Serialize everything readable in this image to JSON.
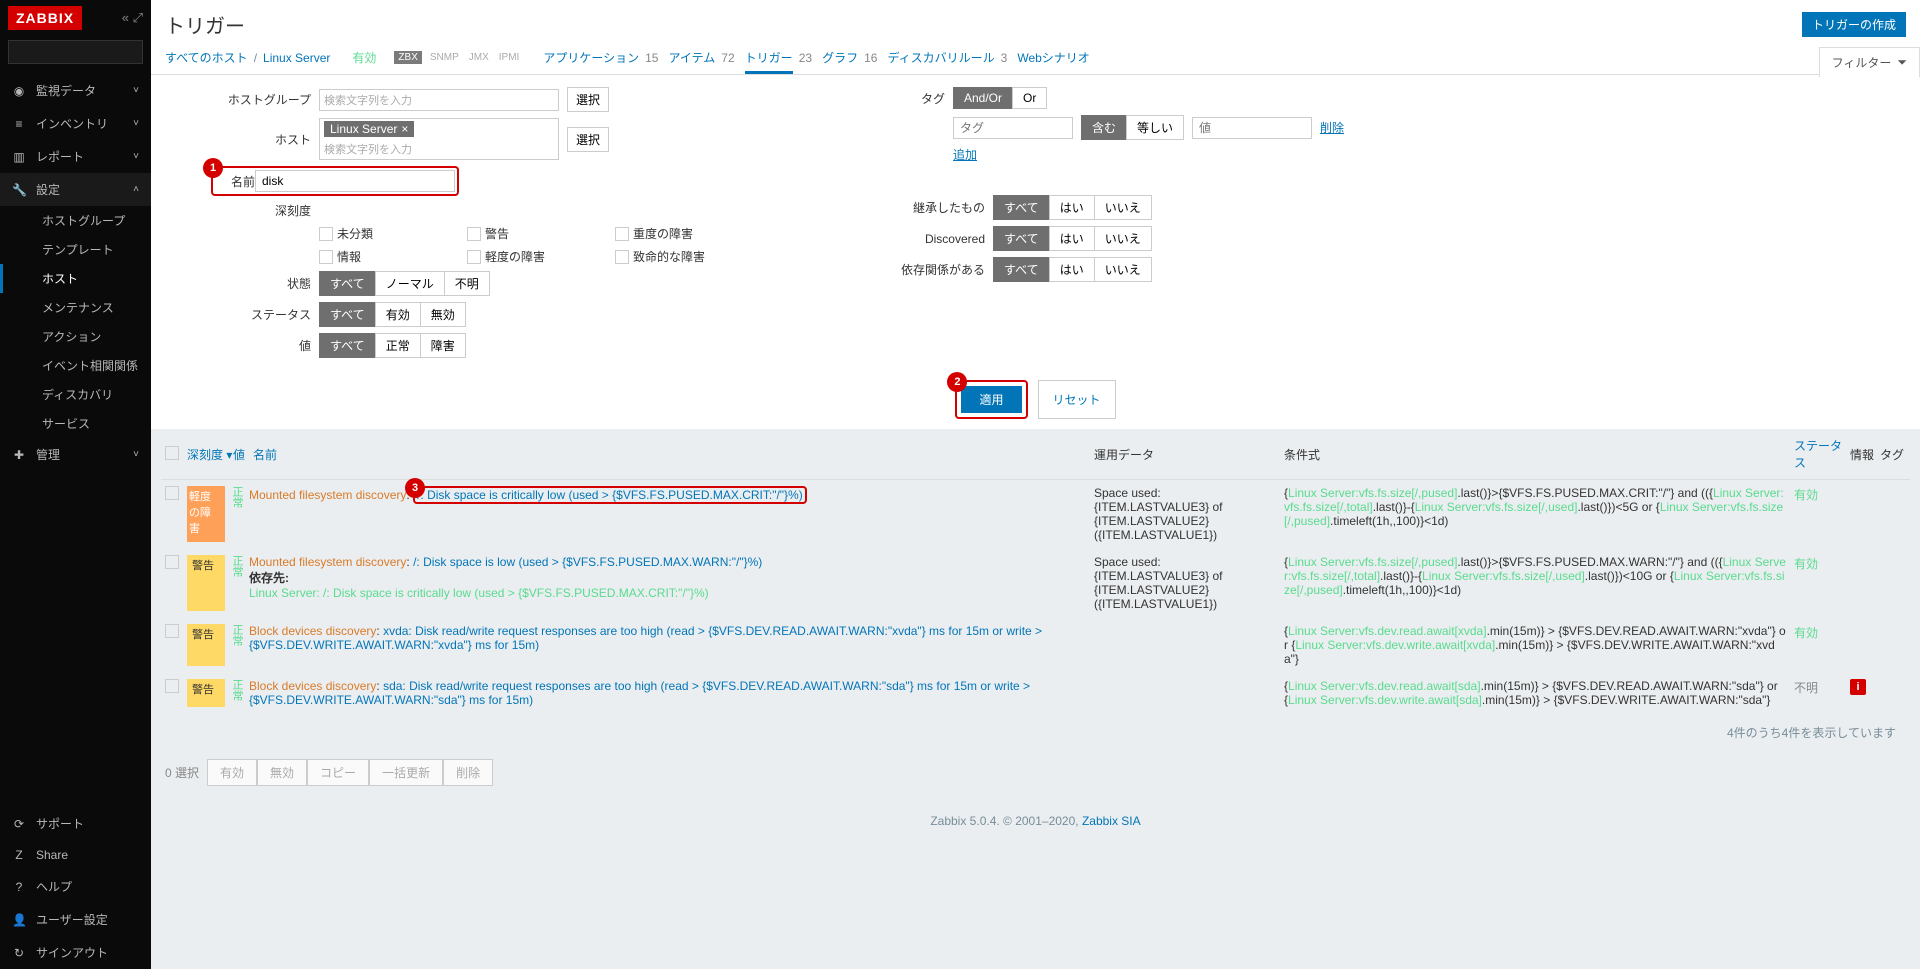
{
  "sidebar": {
    "logo": "ZABBIX",
    "nav": [
      {
        "icon": "◉",
        "label": "監視データ"
      },
      {
        "icon": "≡",
        "label": "インベントリ"
      },
      {
        "icon": "▥",
        "label": "レポート"
      },
      {
        "icon": "🔧",
        "label": "設定",
        "expanded": true,
        "sub": [
          "ホストグループ",
          "テンプレート",
          "ホスト",
          "メンテナンス",
          "アクション",
          "イベント相関関係",
          "ディスカバリ",
          "サービス"
        ],
        "selected": 2
      },
      {
        "icon": "✚",
        "label": "管理"
      }
    ],
    "footer": [
      {
        "icon": "⟳",
        "label": "サポート"
      },
      {
        "icon": "Z",
        "label": "Share"
      },
      {
        "icon": "?",
        "label": "ヘルプ"
      },
      {
        "icon": "👤",
        "label": "ユーザー設定"
      },
      {
        "icon": "↻",
        "label": "サインアウト"
      }
    ]
  },
  "header": {
    "title": "トリガー",
    "create": "トリガーの作成"
  },
  "hostbar": {
    "all": "すべてのホスト",
    "host": "Linux Server",
    "enabled": "有効",
    "zbx": "ZBX",
    "snmp": "SNMP",
    "jmx": "JMX",
    "ipmi": "IPMI",
    "links": [
      {
        "label": "アプリケーション",
        "count": "15"
      },
      {
        "label": "アイテム",
        "count": "72"
      },
      {
        "label": "トリガー",
        "count": "23",
        "active": true
      },
      {
        "label": "グラフ",
        "count": "16"
      },
      {
        "label": "ディスカバリルール",
        "count": "3"
      },
      {
        "label": "Webシナリオ",
        "count": ""
      }
    ],
    "filter": "フィルター"
  },
  "filter": {
    "hostgroup_label": "ホストグループ",
    "hostgroup_placeholder": "検索文字列を入力",
    "select": "選択",
    "host_label": "ホスト",
    "host_value": "Linux Server",
    "host_placeholder": "検索文字列を入力",
    "name_label": "名前",
    "name_value": "disk",
    "severity_label": "深刻度",
    "severities": [
      "未分類",
      "警告",
      "重度の障害",
      "情報",
      "軽度の障害",
      "致命的な障害"
    ],
    "state_label": "状態",
    "state_opts": [
      "すべて",
      "ノーマル",
      "不明"
    ],
    "status_label": "ステータス",
    "status_opts": [
      "すべて",
      "有効",
      "無効"
    ],
    "value_label": "値",
    "value_opts": [
      "すべて",
      "正常",
      "障害"
    ],
    "tags_label": "タグ",
    "tag_andor": "And/Or",
    "tag_or": "Or",
    "tag_key": "タグ",
    "tag_contains": "含む",
    "tag_equals": "等しい",
    "tag_value": "値",
    "tag_remove": "削除",
    "tag_add": "追加",
    "inherit_label": "継承したもの",
    "discover_label": "Discovered",
    "depends_label": "依存関係がある",
    "yn_opts": [
      "すべて",
      "はい",
      "いいえ"
    ],
    "apply": "適用",
    "reset": "リセット"
  },
  "table": {
    "headers": {
      "severity": "深刻度",
      "value": "値",
      "name": "名前",
      "opdata": "運用データ",
      "expression": "条件式",
      "status": "ステータス",
      "info": "情報",
      "tags": "タグ"
    },
    "rows": [
      {
        "severity": "軽度の障害",
        "sev_class": "sev-high",
        "value": "正常",
        "discovery": "Mounted filesystem discovery",
        "name_prefix": "/: ",
        "name": "Disk space is critically low (used > {$VFS.FS.PUSED.MAX.CRIT:\"/\"}%)",
        "highlight": true,
        "opdata": "Space used: {ITEM.LASTVALUE3} of {ITEM.LASTVALUE2} ({ITEM.LASTVALUE1})",
        "expr_parts": [
          {
            "t": "{",
            "c": ""
          },
          {
            "t": "Linux Server:vfs.fs.size[/,pused]",
            "c": "lnk-green"
          },
          {
            "t": ".last()}>{$VFS.FS.PUSED.MAX.CRIT:\"/\"} and (({",
            "c": ""
          },
          {
            "t": "Linux Server:vfs.fs.size[/,total]",
            "c": "lnk-green"
          },
          {
            "t": ".last()}-{",
            "c": ""
          },
          {
            "t": "Linux Server:vfs.fs.size[/,used]",
            "c": "lnk-green"
          },
          {
            "t": ".last()})<5G or {",
            "c": ""
          },
          {
            "t": "Linux Server:vfs.fs.size[/,pused]",
            "c": "lnk-green"
          },
          {
            "t": ".timeleft(1h,,100)}<1d)",
            "c": ""
          }
        ],
        "status": "有効",
        "status_class": "stat-on"
      },
      {
        "severity": "警告",
        "sev_class": "sev-warn",
        "value": "正常",
        "discovery": "Mounted filesystem discovery",
        "name": "/: Disk space is low (used > {$VFS.FS.PUSED.MAX.WARN:\"/\"}%)",
        "depends_label": "依存先:",
        "depends": "Linux Server: /: Disk space is critically low (used > {$VFS.FS.PUSED.MAX.CRIT:\"/\"}%)",
        "opdata": "Space used: {ITEM.LASTVALUE3} of {ITEM.LASTVALUE2} ({ITEM.LASTVALUE1})",
        "expr_parts": [
          {
            "t": "{",
            "c": ""
          },
          {
            "t": "Linux Server:vfs.fs.size[/,pused]",
            "c": "lnk-green"
          },
          {
            "t": ".last()}>{$VFS.FS.PUSED.MAX.WARN:\"/\"} and (({",
            "c": ""
          },
          {
            "t": "Linux Server:vfs.fs.size[/,total]",
            "c": "lnk-green"
          },
          {
            "t": ".last()}-{",
            "c": ""
          },
          {
            "t": "Linux Server:vfs.fs.size[/,used]",
            "c": "lnk-green"
          },
          {
            "t": ".last()})<10G or {",
            "c": ""
          },
          {
            "t": "Linux Server:vfs.fs.size[/,pused]",
            "c": "lnk-green"
          },
          {
            "t": ".timeleft(1h,,100)}<1d)",
            "c": ""
          }
        ],
        "status": "有効",
        "status_class": "stat-on"
      },
      {
        "severity": "警告",
        "sev_class": "sev-warn",
        "value": "正常",
        "discovery": "Block devices discovery",
        "name": "xvda: Disk read/write request responses are too high (read > {$VFS.DEV.READ.AWAIT.WARN:\"xvda\"} ms for 15m or write > {$VFS.DEV.WRITE.AWAIT.WARN:\"xvda\"} ms for 15m)",
        "opdata": "",
        "expr_parts": [
          {
            "t": "{",
            "c": ""
          },
          {
            "t": "Linux Server:vfs.dev.read.await[xvda]",
            "c": "lnk-green"
          },
          {
            "t": ".min(15m)} > {$VFS.DEV.READ.AWAIT.WARN:\"xvda\"} or {",
            "c": ""
          },
          {
            "t": "Linux Server:vfs.dev.write.await[xvda]",
            "c": "lnk-green"
          },
          {
            "t": ".min(15m)} > {$VFS.DEV.WRITE.AWAIT.WARN:\"xvda\"}",
            "c": ""
          }
        ],
        "status": "有効",
        "status_class": "stat-on"
      },
      {
        "severity": "警告",
        "sev_class": "sev-warn",
        "value": "正常",
        "discovery": "Block devices discovery",
        "name": "sda: Disk read/write request responses are too high (read > {$VFS.DEV.READ.AWAIT.WARN:\"sda\"} ms for 15m or write > {$VFS.DEV.WRITE.AWAIT.WARN:\"sda\"} ms for 15m)",
        "opdata": "",
        "expr_parts": [
          {
            "t": "{",
            "c": ""
          },
          {
            "t": "Linux Server:vfs.dev.read.await[sda]",
            "c": "lnk-green"
          },
          {
            "t": ".min(15m)} > {$VFS.DEV.READ.AWAIT.WARN:\"sda\"} or {",
            "c": ""
          },
          {
            "t": "Linux Server:vfs.dev.write.await[sda]",
            "c": "lnk-green"
          },
          {
            "t": ".min(15m)} > {$VFS.DEV.WRITE.AWAIT.WARN:\"sda\"}",
            "c": ""
          }
        ],
        "status": "不明",
        "status_class": "stat-unk",
        "info": true
      }
    ],
    "summary": "4件のうち4件を表示しています"
  },
  "bottombar": {
    "selected": "0 選択",
    "actions": [
      "有効",
      "無効",
      "コピー",
      "一括更新",
      "削除"
    ]
  },
  "copyright": {
    "text": "Zabbix 5.0.4. © 2001–2020, ",
    "link": "Zabbix SIA"
  }
}
